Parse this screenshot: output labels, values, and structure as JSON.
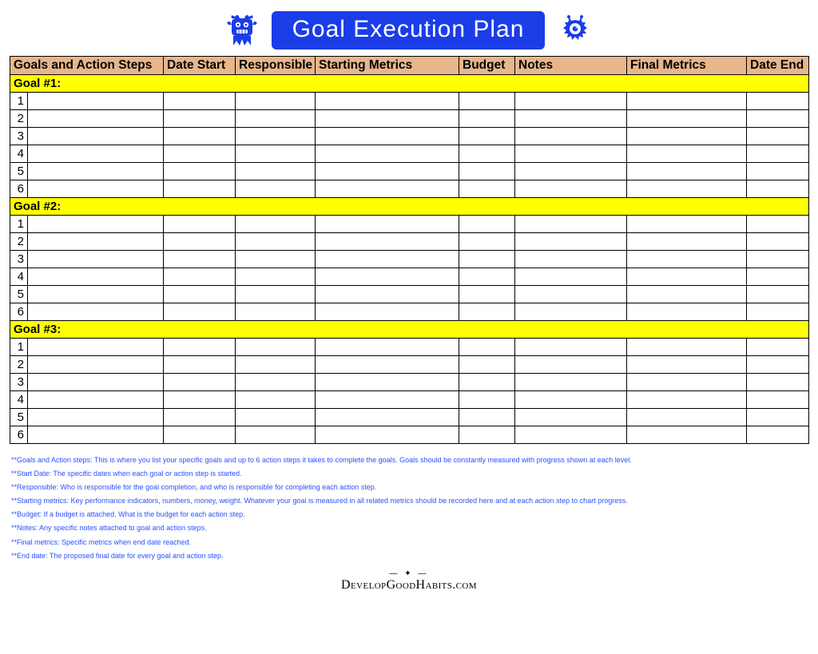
{
  "title": "Goal Execution Plan",
  "headers": {
    "goals": "Goals and Action Steps",
    "date_start": "Date Start",
    "responsible": "Responsible",
    "starting_metrics": "Starting Metrics",
    "budget": "Budget",
    "notes": "Notes",
    "final_metrics": "Final Metrics",
    "date_end": "Date End"
  },
  "goals": [
    {
      "label": "Goal #1:",
      "rows": [
        "1",
        "2",
        "3",
        "4",
        "5",
        "6"
      ]
    },
    {
      "label": "Goal #2:",
      "rows": [
        "1",
        "2",
        "3",
        "4",
        "5",
        "6"
      ]
    },
    {
      "label": "Goal #3:",
      "rows": [
        "1",
        "2",
        "3",
        "4",
        "5",
        "6"
      ]
    }
  ],
  "legend": [
    "**Goals and Action steps: This is where you list your specific goals and up to 6 action steps it takes to complete the goals. Goals should be constantly measured with progress shown at each level.",
    "**Start Date: The specific dates when each goal or action step is started.",
    "**Responsible: Who is responsible for the goal completion, and who is responsible for completing each action step.",
    "**Starting metrics: Key performance indicators, numbers, money, weight. Whatever your goal is measured in all related metrics should be recorded here and at each action step to chart progress.",
    "**Budget: If a budget is attached. What is the budget for each action step.",
    "**Notes:  Any specific notes attached to goal and action steps.",
    "**Final metrics: Specific metrics when end date reached.",
    "**End date: The proposed final date for every goal and action step."
  ],
  "footer_brand": "DevelopGoodHabits.com",
  "decor": {
    "left_icon": "monster-left-icon",
    "right_icon": "monster-right-icon"
  }
}
